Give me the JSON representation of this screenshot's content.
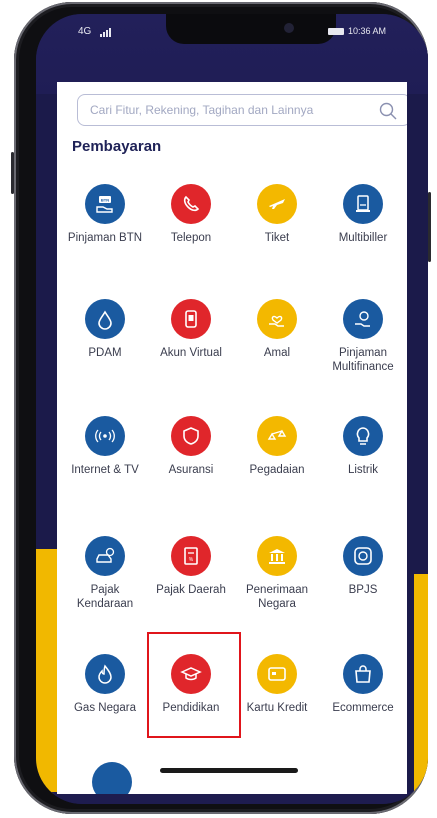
{
  "status_bar": {
    "network": "4G",
    "time": "10:36 AM"
  },
  "search": {
    "placeholder": "Cari Fitur, Rekening, Tagihan dan Lainnya"
  },
  "section": {
    "title": "Pembayaran"
  },
  "menu_items": [
    {
      "label": "Pinjaman BTN",
      "icon": "hand-card-icon",
      "color": "#1a5aa0"
    },
    {
      "label": "Telepon",
      "icon": "phone-icon",
      "color": "#e0262b"
    },
    {
      "label": "Tiket",
      "icon": "airplane-icon",
      "color": "#f3b800"
    },
    {
      "label": "Multibiller",
      "icon": "bill-icon",
      "color": "#1a5aa0"
    },
    {
      "label": "PDAM",
      "icon": "water-drop-icon",
      "color": "#1a5aa0"
    },
    {
      "label": "Akun Virtual",
      "icon": "mobile-account-icon",
      "color": "#e0262b"
    },
    {
      "label": "Amal",
      "icon": "heart-hand-icon",
      "color": "#f3b800"
    },
    {
      "label": "Pinjaman Multifinance",
      "icon": "coin-hand-icon",
      "color": "#1a5aa0"
    },
    {
      "label": "Internet & TV",
      "icon": "broadcast-icon",
      "color": "#1a5aa0"
    },
    {
      "label": "Asuransi",
      "icon": "shield-icon",
      "color": "#e0262b"
    },
    {
      "label": "Pegadaian",
      "icon": "scale-icon",
      "color": "#f3b800"
    },
    {
      "label": "Listrik",
      "icon": "lightbulb-icon",
      "color": "#1a5aa0"
    },
    {
      "label": "Pajak Kendaraan",
      "icon": "car-tax-icon",
      "color": "#1a5aa0"
    },
    {
      "label": "Pajak Daerah",
      "icon": "tax-document-icon",
      "color": "#e0262b"
    },
    {
      "label": "Penerimaan Negara",
      "icon": "government-building-icon",
      "color": "#f3b800"
    },
    {
      "label": "BPJS",
      "icon": "health-badge-icon",
      "color": "#1a5aa0"
    },
    {
      "label": "Gas Negara",
      "icon": "flame-icon",
      "color": "#1a5aa0"
    },
    {
      "label": "Pendidikan",
      "icon": "graduation-cap-icon",
      "color": "#e0262b"
    },
    {
      "label": "Kartu Kredit",
      "icon": "credit-card-icon",
      "color": "#f3b800"
    },
    {
      "label": "Ecommerce",
      "icon": "shopping-bag-icon",
      "color": "#1a5aa0"
    }
  ]
}
